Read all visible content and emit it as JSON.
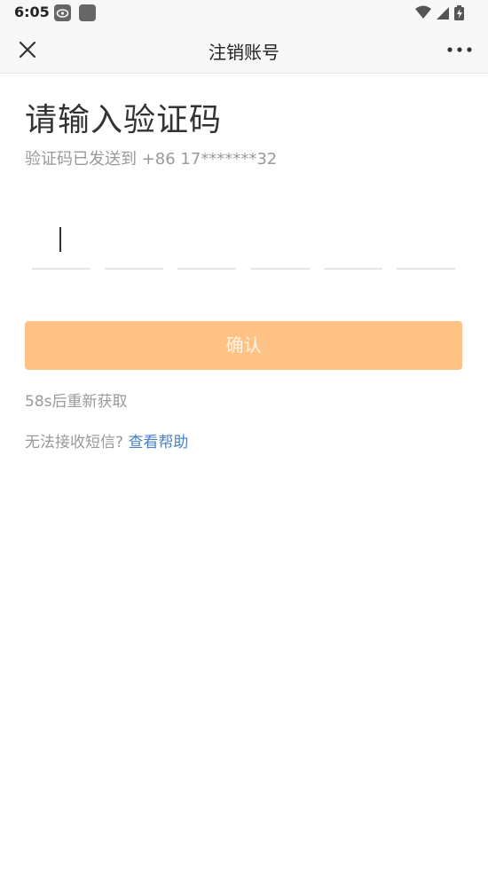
{
  "status_bar": {
    "time": "6:05",
    "icons": [
      "app-notification-icon",
      "app-square-icon",
      "wifi-icon",
      "signal-icon",
      "battery-charging-icon"
    ]
  },
  "header": {
    "title": "注销账号",
    "close_icon": "close-icon",
    "more_icon": "more-horizontal-icon"
  },
  "main": {
    "heading": "请输入验证码",
    "sent_hint": "验证码已发送到 +86 17*******32",
    "code_boxes": [
      "",
      "",
      "",
      "",
      "",
      ""
    ],
    "confirm_label": "确认",
    "resend_text": "58s后重新获取",
    "help_prefix": "无法接收短信?",
    "help_link": "查看帮助"
  },
  "colors": {
    "accent_button": "#ffc285",
    "link": "#4a7fc0",
    "muted_text": "#999999"
  }
}
